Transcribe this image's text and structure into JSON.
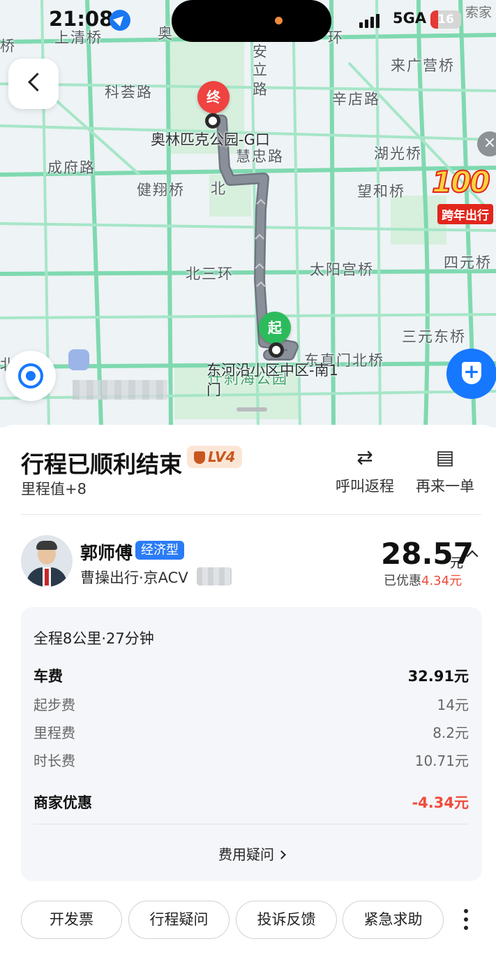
{
  "status_bar": {
    "time": "21:08",
    "network": "5GA",
    "battery": "16",
    "corner_text": "索家"
  },
  "map": {
    "labels": {
      "shangqing": "上清桥",
      "kehuilu": "科荟路",
      "chengfulu": "成府路",
      "jianxiangqiao": "健翔桥",
      "bei": "北",
      "huizhonglu": "慧忠路",
      "anlilu_a": "安",
      "anlilu_b": "立",
      "anlilu_c": "路",
      "ao": "奥",
      "huan": "环",
      "laiguangying": "来广营桥",
      "xindianlu": "辛店路",
      "huguangqiao": "湖光桥",
      "wangheqiao": "望和桥",
      "beisanhuan": "北三环",
      "taiyanggongqiao": "太阳宫桥",
      "siyuanqiao": "四元桥",
      "sanyuandongqiao": "三元东桥",
      "dongzhimenbeiqiao": "东直门北桥",
      "shichahai": "什刹海公园",
      "beizhan": "北站",
      "qiao_left": "桥"
    },
    "destination_name": "奥林匹克公园-G口",
    "origin_name_line1": "东河沿小区中区-南1",
    "origin_name_line2": "门",
    "end_pin": "终",
    "start_pin": "起",
    "promo_number": "100",
    "promo_text": "跨年出行",
    "promo_close": "×",
    "route_color": "#8a9099",
    "road_color": "#7fd9b0"
  },
  "trip": {
    "title": "行程已顺利结束",
    "level_badge": "LV4",
    "mileage_text": "里程值+8",
    "actions": [
      {
        "icon": "⇄",
        "label": "呼叫返程"
      },
      {
        "icon": "▤",
        "label": "再来一单"
      }
    ]
  },
  "driver": {
    "name": "郭师傅",
    "car_type": "经济型",
    "info": "曹操出行·京ACV",
    "price": "28.57",
    "price_unit": "元",
    "discount_prefix": "已优惠",
    "discount_amount": "4.34元"
  },
  "fees": {
    "summary": "全程8公里·27分钟",
    "rows": [
      {
        "label": "车费",
        "value": "32.91元"
      },
      {
        "label": "起步费",
        "value": "14元"
      },
      {
        "label": "里程费",
        "value": "8.2元"
      },
      {
        "label": "时长费",
        "value": "10.71元"
      },
      {
        "label": "商家优惠",
        "value": "-4.34元"
      }
    ],
    "question_link": "费用疑问"
  },
  "buttons": {
    "invoice": "开发票",
    "trip_question": "行程疑问",
    "complaint": "投诉反馈",
    "sos": "紧急求助"
  },
  "colors": {
    "accent_blue": "#1677ff",
    "discount_red": "#f04b3b",
    "start_green": "#2cbb5c",
    "end_red": "#ee4340"
  }
}
